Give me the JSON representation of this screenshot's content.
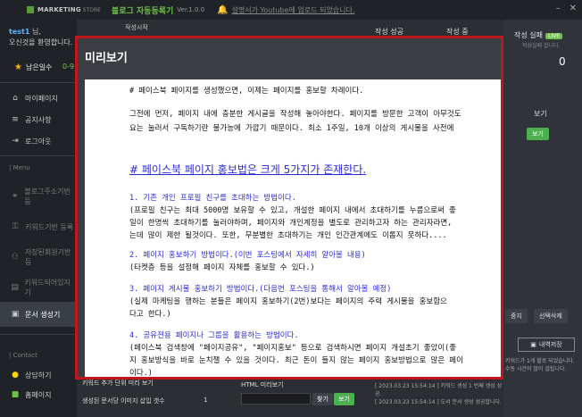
{
  "titlebar": {
    "brand": "MARKETING",
    "brand_sub": "STORE",
    "app_title": "블로그 자동등록기",
    "version": "Ver.1.0.0",
    "notice": "설명서가 Youtube에 업로드 되었습니다."
  },
  "sidebar": {
    "user": "test1",
    "greeting_suffix": "님,",
    "greeting_line2": "오신것을 환영합니다.",
    "remain_label": "남은일수",
    "remain_value": "0-9",
    "items": [
      {
        "icon": "house-icon",
        "label": "마이페이지"
      },
      {
        "icon": "list-icon",
        "label": "공지사항"
      },
      {
        "icon": "logout-icon",
        "label": "로그아웃"
      }
    ],
    "menu_label": "| Menu",
    "menu_items": [
      {
        "label": "블로그주소기반 등"
      },
      {
        "label": "키워드기반 등록"
      },
      {
        "label": "저장된회원기반등"
      },
      {
        "label": "키워드되어있지 기"
      },
      {
        "label": "문서 생성기"
      }
    ],
    "contact_label": "| Contact",
    "contact_items": [
      {
        "label": "상담하기"
      },
      {
        "label": "홈페이지"
      }
    ]
  },
  "top": {
    "tabs": [
      "작성시작",
      "작성중",
      "작성완료"
    ],
    "info1": "작성 성공",
    "info2": "작성 중"
  },
  "right_panel": {
    "title": "작성 실패",
    "live": "LIVE",
    "sub": "작성실패 합니다.",
    "count": "0",
    "blog_label": "보기",
    "view_btn": "보기",
    "stop_btn": "중지",
    "delete_btn": "선택삭제",
    "log_btn": "내역저장",
    "log_text": "키워드가 1개 할로 되었습니다. 수동 시간이 많이 걸립니다."
  },
  "bottom": {
    "label1": "키워드 추가 단위 미리 보기",
    "label2": "생성된 문서당 이미지 삽입 갯수",
    "value2": "1",
    "html_label": "HTML 미리보기",
    "find_btn": "찾기",
    "view_btn": "보기",
    "logs": [
      "[ 2023.03.23 15:54:14 ] 키워드 생성 1 번째 생성 성공.",
      "[ 2023.03.23 15:54:14 ] 도서 문서 생성 성공합니다."
    ]
  },
  "modal": {
    "title": "미리보기",
    "lines": [
      "# 페이스북 페이지를 생성했으면, 이제는 페이지를 홍보할 차례이다.",
      "그전에 먼저, 페이지 내에 충분한 게시글을 작성해 놓아야한다. 페이지를 방문한 고객이 아무것도",
      "요는 눌러서 구독하기란 불가능에 가깝기 때문이다. 최소 1주일, 10개 이상의 게시물을 사전에",
      "# 페이스북 페이지 홍보법은 크게 5가지가 존재한다.",
      "1. 기존 개인 프로필 친구를 초대하는 방법이다.",
      "  (프로필 친구는 최대 5000명 보유할 수 있고, 개설한 페이지 내에서 초대하기를 누름으로써 좋",
      "일이 한명씩 초대하기를 눌러야하며, 페이지와 개인계정을 별도로 관리하고자 하는 관리자라면,",
      "는데 많이 제한 될것이다. 또한, 무분별한 초대하기는 개인 인간관계에도 이롭지 못하다....",
      "2. 페이지 홍보하기 방법이다.(이번 포스팅에서 자세히 알아볼 내용)",
      "  (타켓층 등을 설정해 페이지 자체를 홍보할 수 있다.)",
      "3. 페이지 게시물 홍보하기 방법이다.(다음번 포스팅을 통해서 알아볼 예정)",
      "  (실제 마케팅을 행하는 분들은 페이지 홍보하기(2번)보다는 페이지의 주력 게시물을 홍보합으",
      "다고 한다.)",
      "4. 공유젼용 페이지나 그룹을 활용하는 방법이다.",
      "  (페이스북 검색창에 \"페이지공유\", \"페이지홍보\" 등으로 검색하시면 페이지 개설초기 좋았이(좋",
      "지 홍보방식을 바로 눈치챌 수 있을 것이다. 최근 돈이 들지 않는 페이지 홍보방법으로 많은 페이",
      "이다.)"
    ]
  }
}
